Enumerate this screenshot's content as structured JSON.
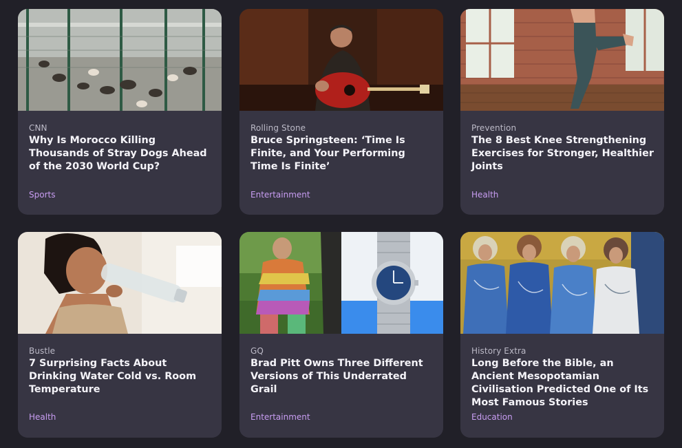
{
  "cards": [
    {
      "source": "CNN",
      "title": "Why Is Morocco Killing Thousands of Stray Dogs Ahead of the 2030 World Cup?",
      "category": "Sports"
    },
    {
      "source": "Rolling Stone",
      "title": "Bruce Springsteen: ‘Time Is Finite, and Your Performing Time Is Finite’",
      "category": "Entertainment"
    },
    {
      "source": "Prevention",
      "title": "The 8 Best Knee Strengthening Exercises for Stronger, Healthier Joints",
      "category": "Health"
    },
    {
      "source": "Bustle",
      "title": "7 Surprising Facts About Drinking Water Cold vs. Room Temperature",
      "category": "Health"
    },
    {
      "source": "GQ",
      "title": "Brad Pitt Owns Three Different Versions of This Underrated Grail",
      "category": "Entertainment"
    },
    {
      "source": "History Extra",
      "title": "Long Before the Bible, an Ancient Mesopotamian Civilisation Predicted One of Its Most Famous Stories",
      "category": "Education"
    }
  ],
  "colors": {
    "page_background": "#212028",
    "card_background": "#373543",
    "source_text": "#bcbac7",
    "title_text": "#f4f3f8",
    "category_text": "#c89df2"
  }
}
